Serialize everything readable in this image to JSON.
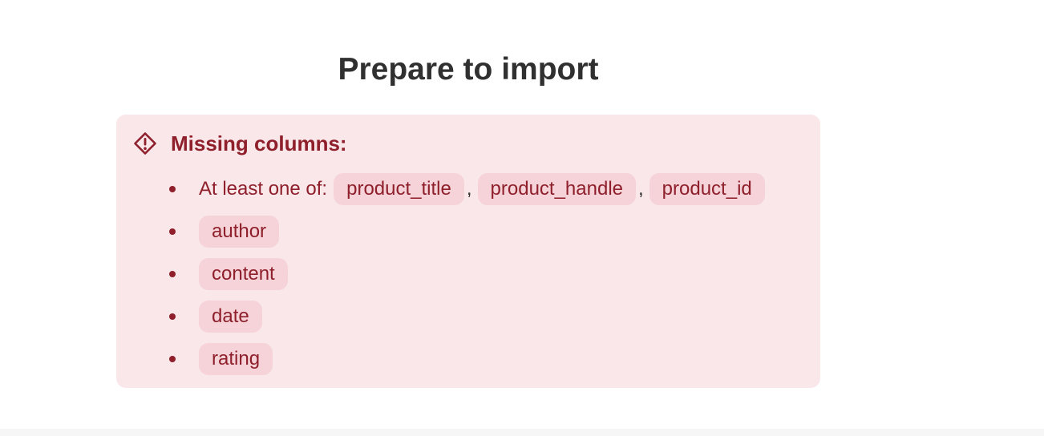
{
  "page": {
    "title": "Prepare to import"
  },
  "banner": {
    "title": "Missing columns:",
    "icon": "alert-diamond-icon",
    "accent_color": "#8e1f2b",
    "background_color": "#f9e7e9",
    "chip_color": "#f5d3d8",
    "first_item": {
      "text": "At least one of:",
      "options": [
        "product_title",
        "product_handle",
        "product_id"
      ],
      "separator": ","
    },
    "columns": [
      "author",
      "content",
      "date",
      "rating"
    ]
  }
}
